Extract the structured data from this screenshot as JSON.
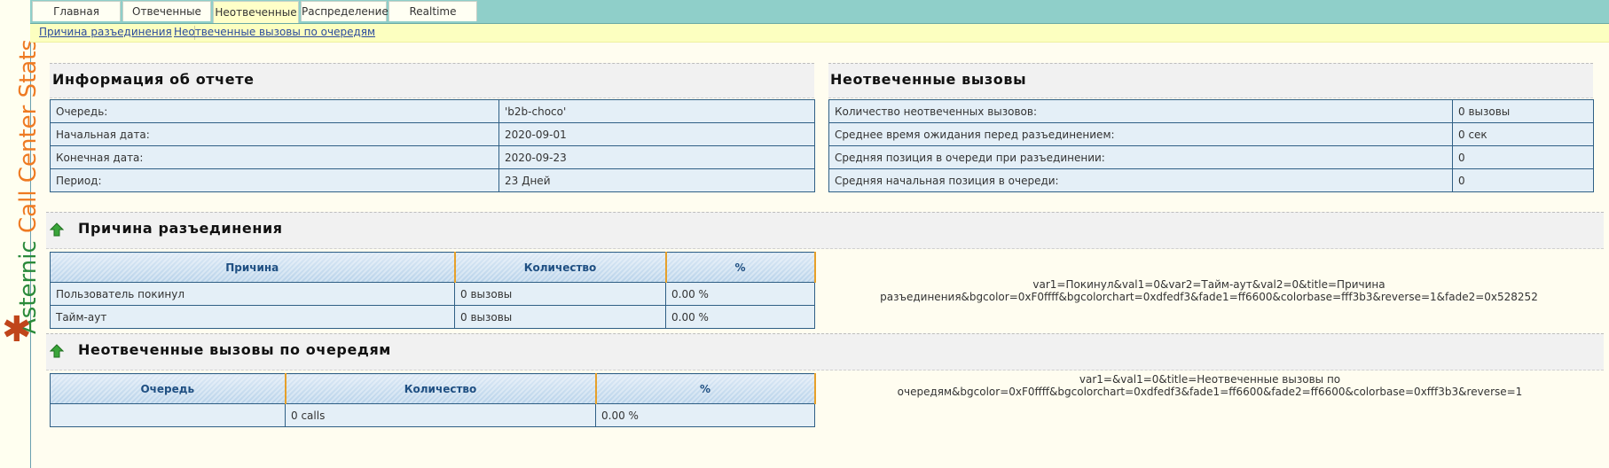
{
  "brand": {
    "word1": "Asternic",
    "word2": "Call Center Stats",
    "star": "✱"
  },
  "nav": {
    "tabs": [
      {
        "label": "Главная"
      },
      {
        "label": "Отвеченные"
      },
      {
        "label": "Неотвеченные",
        "active": true
      },
      {
        "label": "Распределение"
      },
      {
        "label": "Realtime"
      }
    ]
  },
  "subnav": {
    "links": [
      {
        "label": "Причина разъединения"
      },
      {
        "label": "Неотвеченные вызовы по очередям"
      }
    ]
  },
  "report_info": {
    "title": "Информация об отчете",
    "rows": [
      {
        "label": "Очередь:",
        "value": "'b2b-choco'"
      },
      {
        "label": "Начальная дата:",
        "value": "2020-09-01"
      },
      {
        "label": "Конечная дата:",
        "value": "2020-09-23"
      },
      {
        "label": "Период:",
        "value": "23 Дней"
      }
    ]
  },
  "unanswered": {
    "title": "Неотвеченные вызовы",
    "rows": [
      {
        "label": "Количество неотвеченных вызовов:",
        "value": "0 вызовы"
      },
      {
        "label": "Среднее время ожидания перед разъединением:",
        "value": "0 сек"
      },
      {
        "label": "Средняя позиция в очереди при разъединении:",
        "value": "0"
      },
      {
        "label": "Средняя начальная позиция в очереди:",
        "value": "0"
      }
    ]
  },
  "disconnect": {
    "title": "Причина разъединения",
    "headers": [
      "Причина",
      "Количество",
      "%"
    ],
    "rows": [
      [
        "Пользователь покинул",
        "0 вызовы",
        "0.00 %"
      ],
      [
        "Тайм-аут",
        "0 вызовы",
        "0.00 %"
      ]
    ],
    "chart_text_line1": "var1=Покинул&val1=0&var2=Тайм-аут&val2=0&title=Причина",
    "chart_text_line2": "разъединения&bgcolor=0xF0ffff&bgcolorchart=0xdfedf3&fade1=ff6600&colorbase=fff3b3&reverse=1&fade2=0x528252"
  },
  "by_queue": {
    "title": "Неотвеченные вызовы по очередям",
    "headers": [
      "Очередь",
      "Количество",
      "%"
    ],
    "rows": [
      [
        "",
        "0 calls",
        "0.00 %"
      ]
    ],
    "chart_text": "var1=&val1=0&title=Неотвеченные вызовы по очередям&bgcolor=0xF0ffff&bgcolorchart=0xdfedf3&fade1=ff6600&fade2=ff6600&colorbase=0xfff3b3&reverse=1"
  },
  "colors": {
    "topbar": "#8fcfc9",
    "subbar": "#fcffc0",
    "cell_bg": "#e4eff7",
    "border": "#2f5f85",
    "header_text": "#1f4f82",
    "arrow_green": "#3aa53a"
  }
}
